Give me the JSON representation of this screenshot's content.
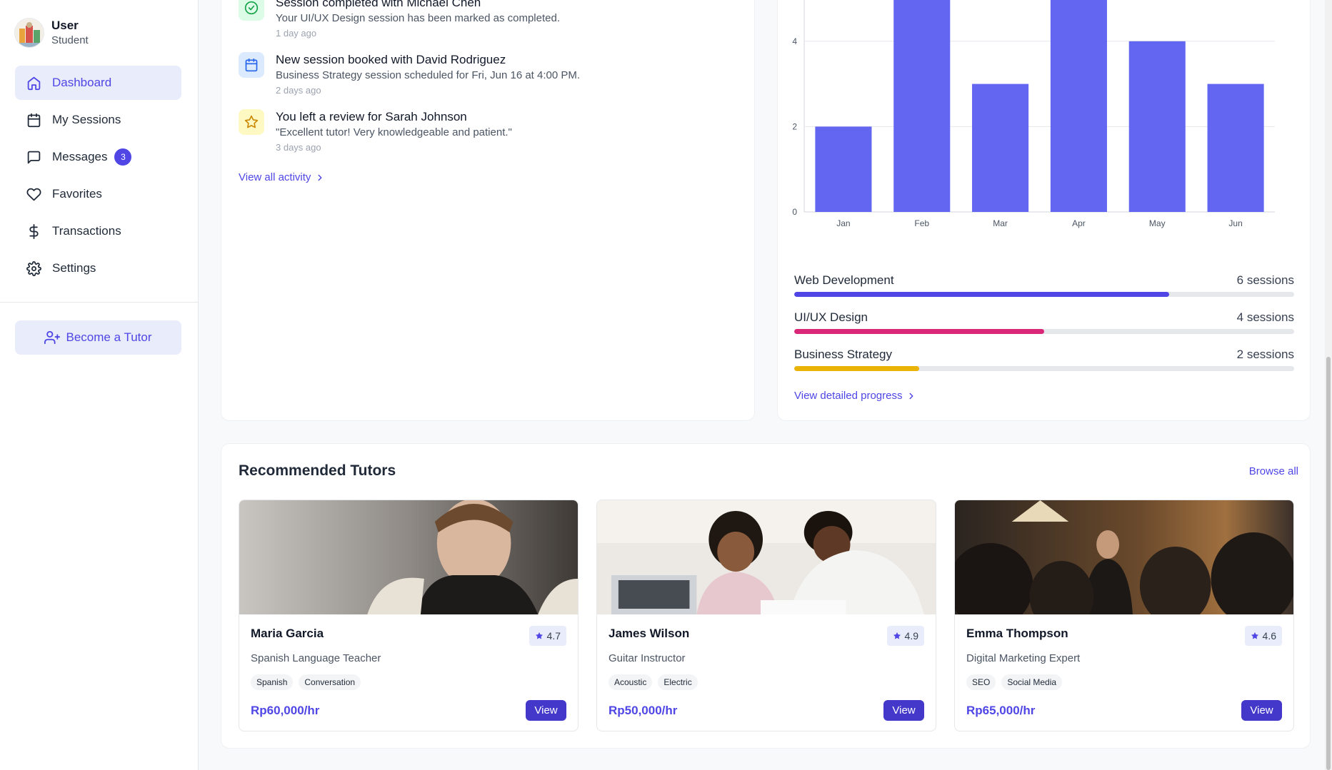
{
  "sidebar": {
    "user_name": "User",
    "user_role": "Student",
    "nav": [
      {
        "label": "Dashboard",
        "icon": "home-icon",
        "active": true
      },
      {
        "label": "My Sessions",
        "icon": "calendar-icon"
      },
      {
        "label": "Messages",
        "icon": "message-icon",
        "badge": "3"
      },
      {
        "label": "Favorites",
        "icon": "heart-icon"
      },
      {
        "label": "Transactions",
        "icon": "dollar-icon"
      },
      {
        "label": "Settings",
        "icon": "gear-icon"
      }
    ],
    "become_tutor": "Become a Tutor"
  },
  "activity": {
    "items": [
      {
        "title": "Session completed with Michael Chen",
        "desc": "Your UI/UX Design session has been marked as completed.",
        "time": "1 day ago",
        "icon": "check-circle-icon",
        "color": "#16a34a"
      },
      {
        "title": "New session booked with David Rodriguez",
        "desc": "Business Strategy session scheduled for Fri, Jun 16 at 4:00 PM.",
        "time": "2 days ago",
        "icon": "calendar-icon",
        "color": "#2563eb"
      },
      {
        "title": "You left a review for Sarah Johnson",
        "desc": "\"Excellent tutor! Very knowledgeable and patient.\"",
        "time": "3 days ago",
        "icon": "star-icon",
        "color": "#ca8a04"
      }
    ],
    "view_all": "View all activity"
  },
  "chart_data": {
    "type": "bar",
    "categories": [
      "Jan",
      "Feb",
      "Mar",
      "Apr",
      "May",
      "Jun"
    ],
    "values": [
      2,
      5,
      3,
      5,
      4,
      3
    ],
    "yticks": [
      0,
      2,
      4
    ],
    "ylim": [
      0,
      5
    ],
    "color": "#6366f1",
    "grid": true
  },
  "progress": {
    "items": [
      {
        "label": "Web Development",
        "count": "6 sessions",
        "value": 0.75,
        "color": "#4f46e5"
      },
      {
        "label": "UI/UX Design",
        "count": "4 sessions",
        "value": 0.5,
        "color": "#db2777"
      },
      {
        "label": "Business Strategy",
        "count": "2 sessions",
        "value": 0.25,
        "color": "#eab308"
      }
    ],
    "view_detailed": "View detailed progress"
  },
  "tutors": {
    "title": "Recommended Tutors",
    "browse_all": "Browse all",
    "view_label": "View",
    "items": [
      {
        "name": "Maria Garcia",
        "rating": "4.7",
        "role": "Spanish Language Teacher",
        "tags": [
          "Spanish",
          "Conversation"
        ],
        "price": "Rp60,000/hr"
      },
      {
        "name": "James Wilson",
        "rating": "4.9",
        "role": "Guitar Instructor",
        "tags": [
          "Acoustic",
          "Electric"
        ],
        "price": "Rp50,000/hr"
      },
      {
        "name": "Emma Thompson",
        "rating": "4.6",
        "role": "Digital Marketing Expert",
        "tags": [
          "SEO",
          "Social Media"
        ],
        "price": "Rp65,000/hr"
      }
    ]
  }
}
